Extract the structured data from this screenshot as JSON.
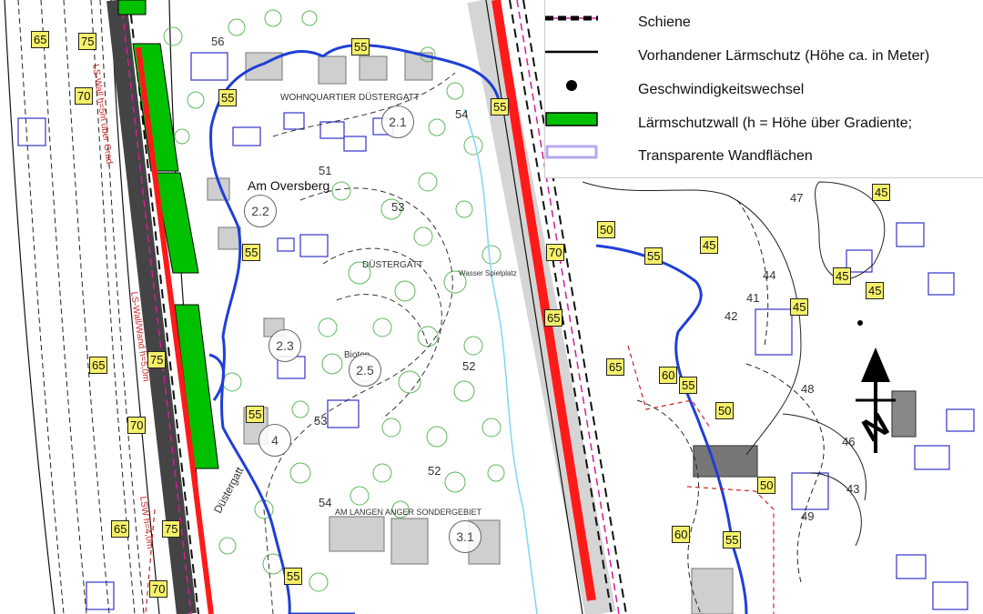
{
  "legend": {
    "items": [
      {
        "label": "Schiene",
        "symbol": "rail-dashed"
      },
      {
        "label": "Vorhandener Lärmschutz (Höhe ca. in Meter)",
        "symbol": "line-black"
      },
      {
        "label": "Geschwindigkeitswechsel",
        "symbol": "dot-black"
      },
      {
        "label": "Lärmschutzwall (h = Höhe über Gradiente;",
        "symbol": "box-green"
      },
      {
        "label": "Transparente Wandflächen",
        "symbol": "box-lilac"
      }
    ]
  },
  "colors": {
    "noise_wall": "#ff1a1a",
    "green_wall": "#00c000",
    "blue_contour": "#1f3fd6",
    "tag_fill": "#f5f06a",
    "rail": "#d61a9c",
    "buildings": "#3333cc",
    "trees": "#5cb85c"
  },
  "place_labels": {
    "street_oversberg": "Am Oversberg",
    "area_dustergatt": "DÜSTERGATT",
    "wohnquartier": "WOHNQUARTIER DÜSTERGATT",
    "biotop": "Biotop",
    "sondergebiet": "AM LANGEN ANGER SONDERGEBIET",
    "street_dustergatt": "Düstergatt",
    "wasserspielplatz": "Wasser Spielplatz",
    "plan_wall_note_1": "LS-Wall h=5m über Grad.",
    "plan_wall_note_2": "LS-Wall/Wand h=5,0m",
    "plan_wall_note_3": "LSW h=4,0m"
  },
  "areas": [
    "2.1",
    "2.2",
    "2.3",
    "2.5",
    "3.1",
    "4"
  ],
  "contour_tags": [
    {
      "text": "65"
    },
    {
      "text": "75"
    },
    {
      "text": "70"
    },
    {
      "text": "55"
    },
    {
      "text": "55"
    },
    {
      "text": "55"
    },
    {
      "text": "55"
    },
    {
      "text": "55"
    },
    {
      "text": "55"
    },
    {
      "text": "65"
    },
    {
      "text": "60"
    },
    {
      "text": "50"
    },
    {
      "text": "45"
    },
    {
      "text": "45"
    },
    {
      "text": "45"
    },
    {
      "text": "45"
    },
    {
      "text": "50"
    },
    {
      "text": "50"
    },
    {
      "text": "55"
    },
    {
      "text": "75"
    },
    {
      "text": "65"
    },
    {
      "text": "70"
    },
    {
      "text": "75"
    },
    {
      "text": "70"
    },
    {
      "text": "65"
    },
    {
      "text": "55"
    },
    {
      "text": "60"
    },
    {
      "text": "65"
    },
    {
      "text": "70"
    },
    {
      "text": "55"
    },
    {
      "text": "45"
    }
  ],
  "contour_numbers": [
    "56",
    "54",
    "53",
    "52",
    "51",
    "53",
    "52",
    "54",
    "47",
    "44",
    "46",
    "48",
    "49",
    "43",
    "42",
    "41"
  ]
}
